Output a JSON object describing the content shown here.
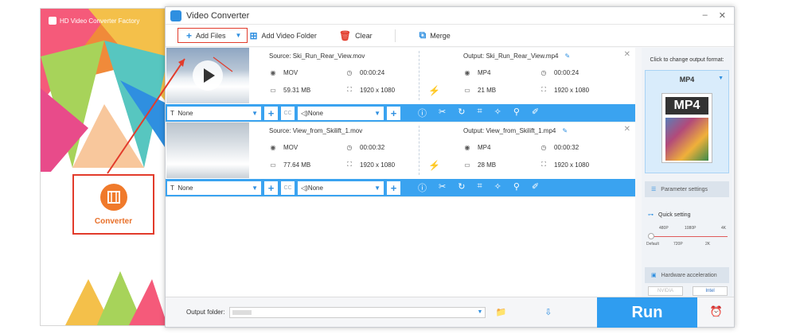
{
  "launcher": {
    "title": "HD Video Converter Factory",
    "converter_label": "Converter"
  },
  "window": {
    "title": "Video Converter",
    "minimize": "–",
    "close": "✕"
  },
  "toolbar": {
    "add_files": "Add Files",
    "add_video_folder": "Add Video Folder",
    "clear": "Clear",
    "merge": "Merge"
  },
  "items": [
    {
      "source": "Source: Ski_Run_Rear_View.mov",
      "format": "MOV",
      "duration": "00:00:24",
      "size": "59.31 MB",
      "resolution": "1920 x 1080",
      "output": "Output: Ski_Run_Rear_View.mp4",
      "out_format": "MP4",
      "out_duration": "00:00:24",
      "out_size": "21 MB",
      "out_resolution": "1920 x 1080",
      "subtitle": "None",
      "audio": "None"
    },
    {
      "source": "Source: View_from_Skilift_1.mov",
      "format": "MOV",
      "duration": "00:00:32",
      "size": "77.64 MB",
      "resolution": "1920 x 1080",
      "output": "Output: View_from_Skilift_1.mp4",
      "out_format": "MP4",
      "out_duration": "00:00:32",
      "out_size": "28 MB",
      "out_resolution": "1920 x 1080",
      "subtitle": "None",
      "audio": "None"
    }
  ],
  "right_panel": {
    "hint": "Click to change output format:",
    "format_name": "MP4",
    "format_icon_text": "MP4",
    "parameter_settings": "Parameter settings",
    "quick_setting": "Quick setting",
    "res_top": [
      "480P",
      "1080P",
      "4K"
    ],
    "res_bottom": [
      "Default",
      "720P",
      "2K"
    ],
    "hardware_acceleration": "Hardware acceleration",
    "nvidia": "NVIDIA",
    "intel": "Intel"
  },
  "bottom": {
    "output_folder_label": "Output folder:",
    "run": "Run"
  },
  "colors": {
    "accent": "#2f9df0",
    "annotation_red": "#e23b2b",
    "bolt": "#f59b22"
  }
}
